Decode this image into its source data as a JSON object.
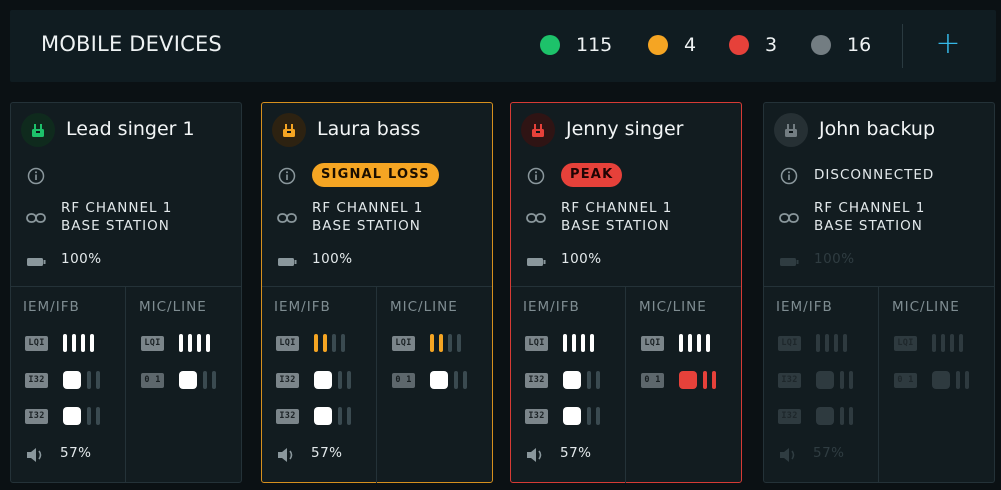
{
  "header": {
    "title": "MOBILE DEVICES",
    "stats": [
      {
        "count": "115",
        "color": "#1dc26a"
      },
      {
        "count": "4",
        "color": "#f5a523"
      },
      {
        "count": "3",
        "color": "#e6413a"
      },
      {
        "count": "16",
        "color": "#737d82"
      }
    ],
    "add_label": "+"
  },
  "cards": [
    {
      "name": "Lead singer 1",
      "state": "ok",
      "status": "",
      "rf_line1": "RF CHANNEL 1",
      "rf_line2": "BASE STATION",
      "battery": "100%",
      "volume": "57%",
      "iem_header": "IEM/IFB",
      "mic_header": "MIC/LINE",
      "tags": {
        "lqi": "LQI",
        "i32": "I32",
        "zero_one": "0 1"
      },
      "iem_lqi_level": 4,
      "mic_lqi_level": 4
    },
    {
      "name": "Laura bass",
      "state": "warn",
      "status": "SIGNAL LOSS",
      "rf_line1": "RF CHANNEL 1",
      "rf_line2": "BASE STATION",
      "battery": "100%",
      "volume": "57%",
      "iem_header": "IEM/IFB",
      "mic_header": "MIC/LINE",
      "tags": {
        "lqi": "LQI",
        "i32": "I32",
        "zero_one": "0 1"
      },
      "iem_lqi_level": 2,
      "mic_lqi_level": 2
    },
    {
      "name": "Jenny singer",
      "state": "err",
      "status": "PEAK",
      "rf_line1": "RF CHANNEL 1",
      "rf_line2": "BASE STATION",
      "battery": "100%",
      "volume": "57%",
      "iem_header": "IEM/IFB",
      "mic_header": "MIC/LINE",
      "tags": {
        "lqi": "LQI",
        "i32": "I32",
        "zero_one": "0 1"
      },
      "iem_lqi_level": 4,
      "mic_lqi_level": 4
    },
    {
      "name": "John backup",
      "state": "off",
      "status": "DISCONNECTED",
      "rf_line1": "RF CHANNEL 1",
      "rf_line2": "BASE STATION",
      "battery": "100%",
      "volume": "57%",
      "iem_header": "IEM/IFB",
      "mic_header": "MIC/LINE",
      "tags": {
        "lqi": "LQI",
        "i32": "I32",
        "zero_one": "0 1"
      },
      "iem_lqi_level": 4,
      "mic_lqi_level": 4
    }
  ],
  "colors": {
    "ok": "#1dc26a",
    "warn": "#f5a523",
    "err": "#e6413a",
    "off": "#737d82",
    "accent": "#35b7e6"
  },
  "icons": {
    "device": "transmitter-icon",
    "info": "info-icon",
    "link": "link-icon",
    "battery": "battery-icon",
    "volume": "speaker-icon",
    "add": "plus-icon"
  }
}
